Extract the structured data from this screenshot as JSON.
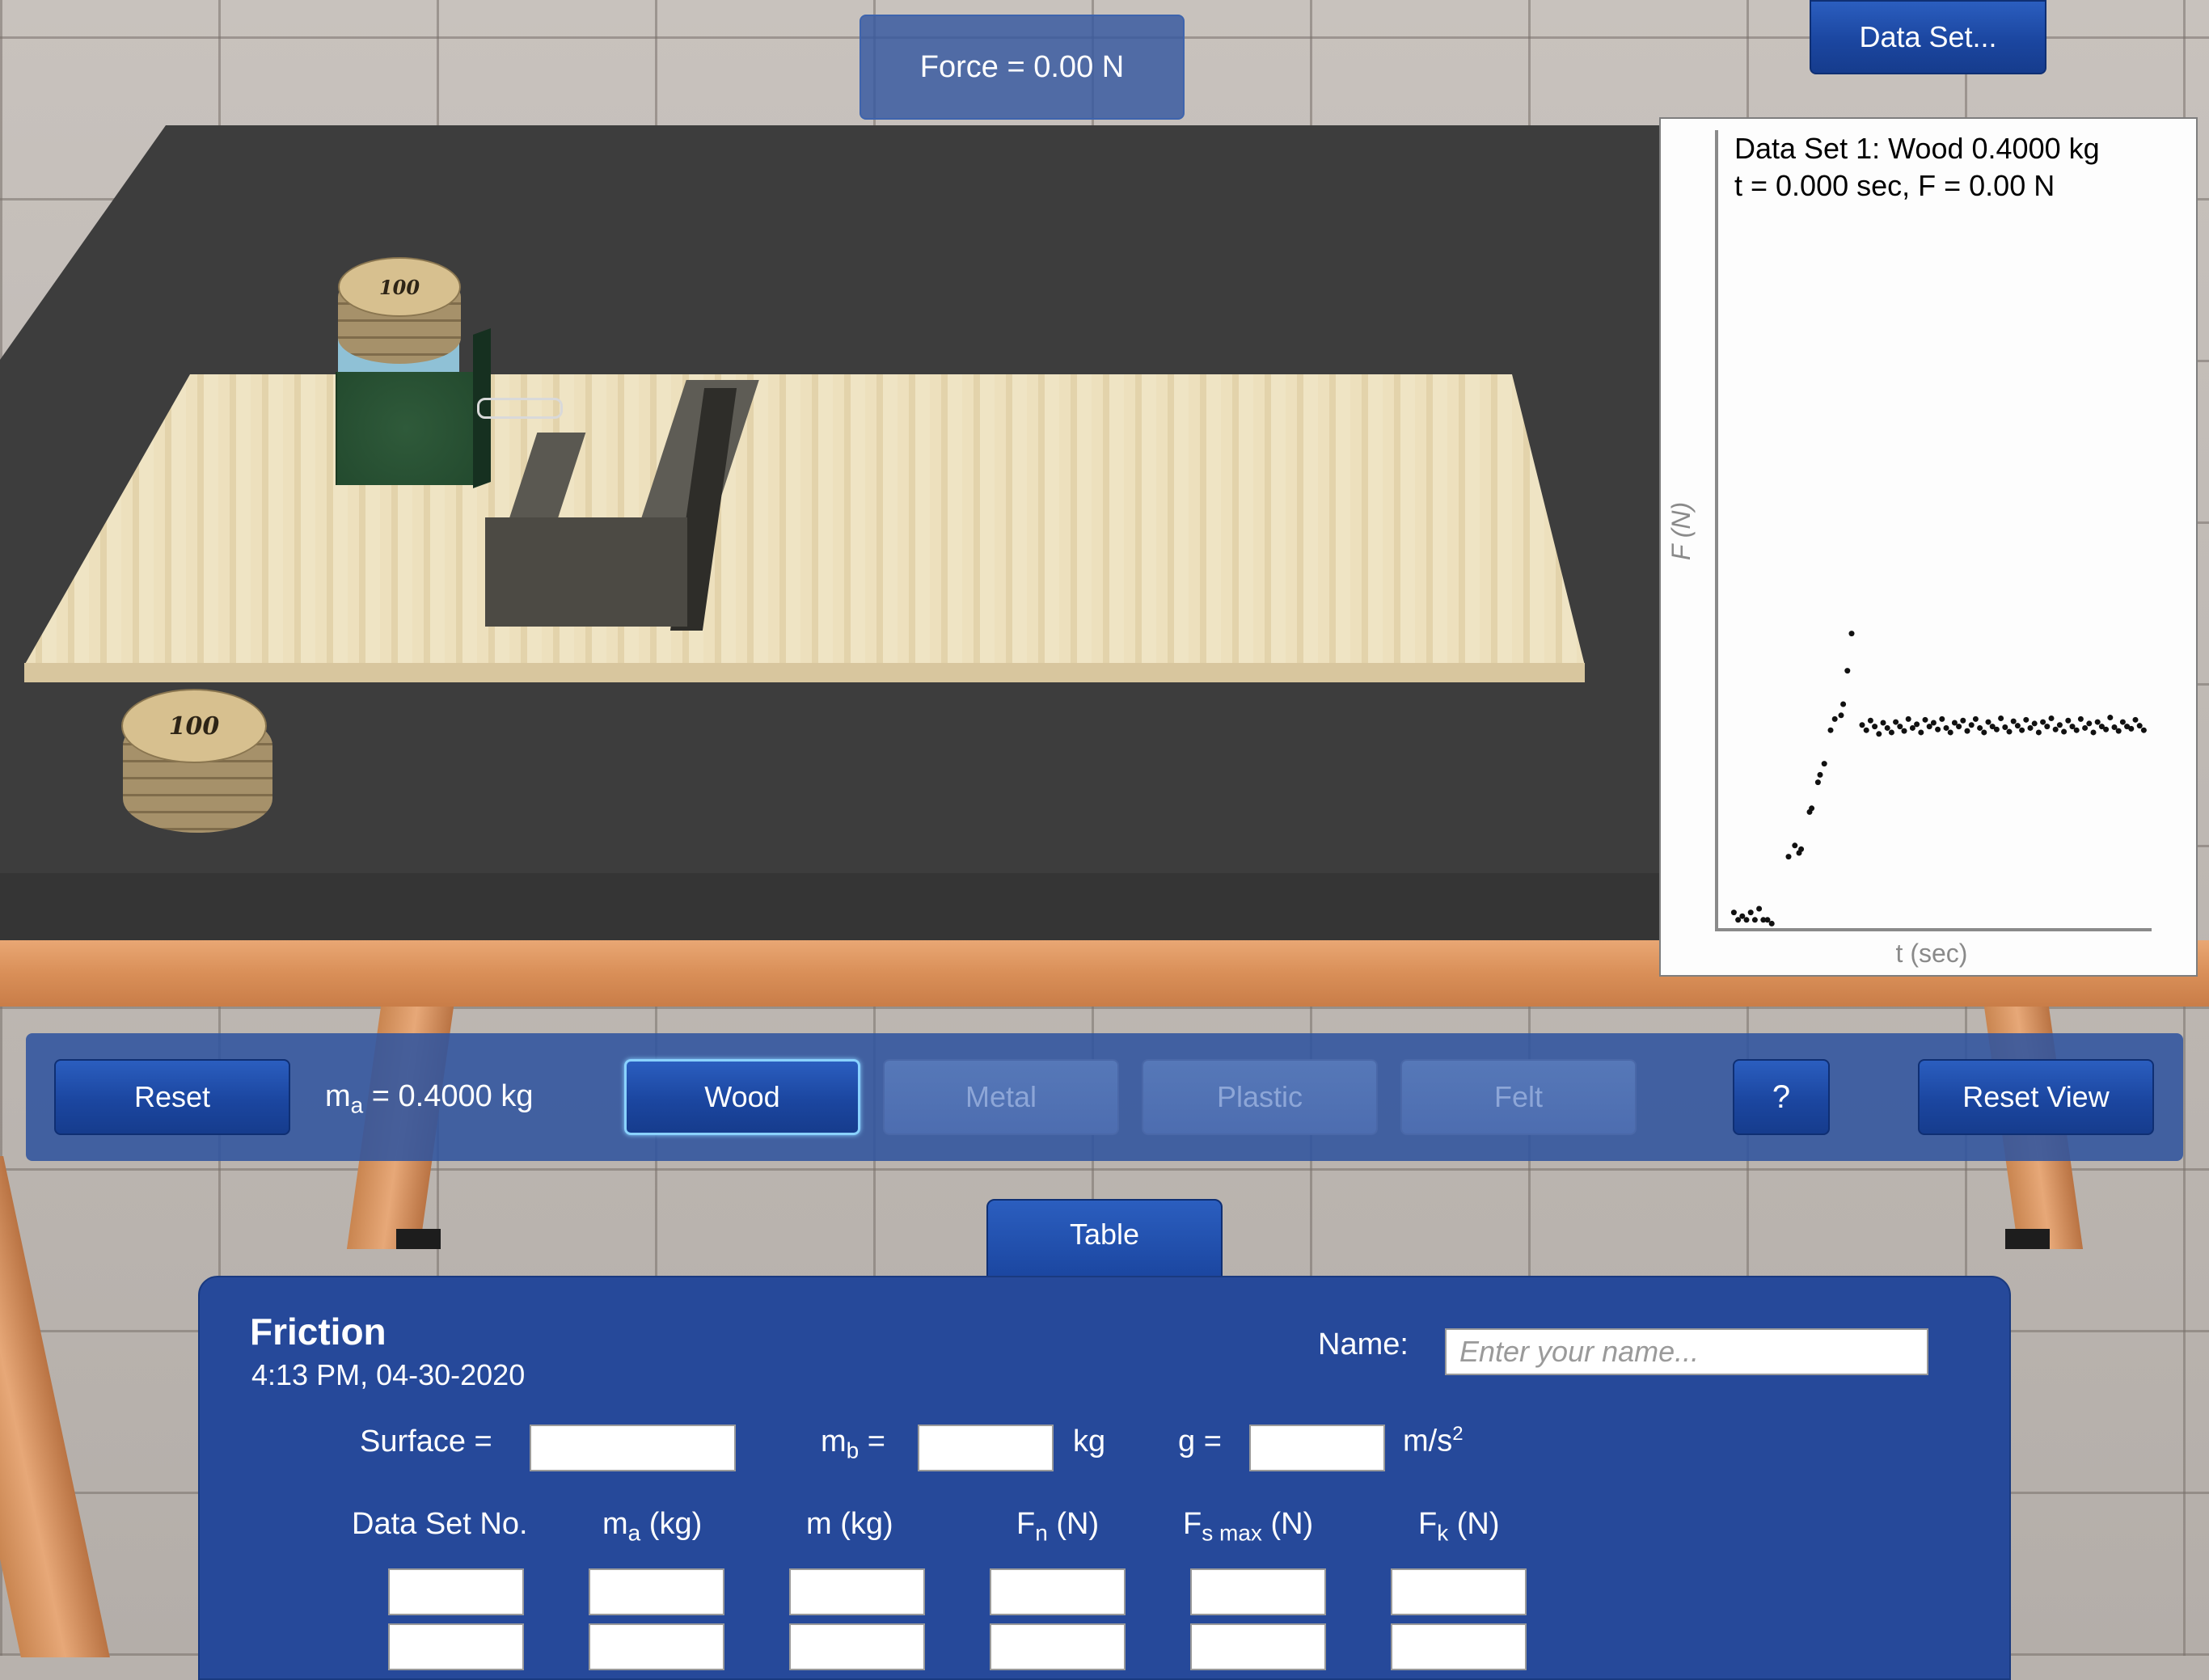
{
  "force_display": {
    "text": "Force = 0.00 N"
  },
  "header": {
    "dataset_button": "Data Set..."
  },
  "graph": {
    "title_line1": "Data Set 1: Wood 0.4000 kg",
    "title_line2": "t = 0.000 sec,  F = 0.00 N"
  },
  "weights": {
    "label": "100"
  },
  "toolbar": {
    "reset": "Reset",
    "mass_prefix": "m",
    "mass_sub": "a",
    "mass_value": " = 0.4000 kg",
    "surfaces": [
      "Wood",
      "Metal",
      "Plastic",
      "Felt"
    ],
    "selected_surface": "Wood",
    "help": "?",
    "reset_view": "Reset View"
  },
  "tab": {
    "label": "Table"
  },
  "panel": {
    "title": "Friction",
    "timestamp": "4:13 PM, 04-30-2020",
    "name_label": "Name:",
    "name_placeholder": "Enter your name...",
    "surface_label": "Surface =",
    "mb_prefix": "m",
    "mb_sub": "b",
    "mb_eq": " =",
    "mb_unit": "kg",
    "g_label": "g =",
    "g_unit": "m/s",
    "g_unit_sup": "2",
    "columns": [
      {
        "main": "Data Set No.",
        "sub": "",
        "rest": ""
      },
      {
        "main": "m",
        "sub": "a",
        "rest": " (kg)"
      },
      {
        "main": "m (kg)",
        "sub": "",
        "rest": ""
      },
      {
        "main": "F",
        "sub": "n",
        "rest": " (N)"
      },
      {
        "main": "F",
        "sub": "s max",
        "rest": " (N)"
      },
      {
        "main": "F",
        "sub": "k",
        "rest": " (N)"
      }
    ]
  },
  "chart_data": {
    "type": "scatter",
    "title": "",
    "xlabel": "t (sec)",
    "ylabel": "F (N)",
    "xlim": [
      0,
      1
    ],
    "ylim": [
      0,
      1
    ],
    "grid": false,
    "points": [
      [
        0.02,
        0.02
      ],
      [
        0.03,
        0.01
      ],
      [
        0.04,
        0.015
      ],
      [
        0.05,
        0.01
      ],
      [
        0.06,
        0.02
      ],
      [
        0.07,
        0.01
      ],
      [
        0.08,
        0.025
      ],
      [
        0.09,
        0.01
      ],
      [
        0.1,
        0.01
      ],
      [
        0.11,
        0.005
      ],
      [
        0.15,
        0.095
      ],
      [
        0.165,
        0.11
      ],
      [
        0.175,
        0.1
      ],
      [
        0.18,
        0.105
      ],
      [
        0.2,
        0.155
      ],
      [
        0.205,
        0.16
      ],
      [
        0.22,
        0.195
      ],
      [
        0.225,
        0.205
      ],
      [
        0.235,
        0.22
      ],
      [
        0.25,
        0.265
      ],
      [
        0.26,
        0.28
      ],
      [
        0.275,
        0.285
      ],
      [
        0.28,
        0.3
      ],
      [
        0.29,
        0.345
      ],
      [
        0.3,
        0.395
      ],
      [
        0.325,
        0.272
      ],
      [
        0.335,
        0.265
      ],
      [
        0.345,
        0.278
      ],
      [
        0.355,
        0.27
      ],
      [
        0.365,
        0.26
      ],
      [
        0.375,
        0.275
      ],
      [
        0.385,
        0.268
      ],
      [
        0.395,
        0.262
      ],
      [
        0.405,
        0.276
      ],
      [
        0.415,
        0.27
      ],
      [
        0.425,
        0.264
      ],
      [
        0.435,
        0.28
      ],
      [
        0.445,
        0.268
      ],
      [
        0.455,
        0.273
      ],
      [
        0.465,
        0.262
      ],
      [
        0.475,
        0.279
      ],
      [
        0.485,
        0.27
      ],
      [
        0.495,
        0.275
      ],
      [
        0.505,
        0.266
      ],
      [
        0.515,
        0.28
      ],
      [
        0.525,
        0.268
      ],
      [
        0.535,
        0.262
      ],
      [
        0.545,
        0.275
      ],
      [
        0.555,
        0.27
      ],
      [
        0.565,
        0.278
      ],
      [
        0.575,
        0.264
      ],
      [
        0.585,
        0.272
      ],
      [
        0.595,
        0.28
      ],
      [
        0.605,
        0.268
      ],
      [
        0.615,
        0.262
      ],
      [
        0.625,
        0.276
      ],
      [
        0.635,
        0.27
      ],
      [
        0.645,
        0.266
      ],
      [
        0.655,
        0.281
      ],
      [
        0.665,
        0.269
      ],
      [
        0.675,
        0.263
      ],
      [
        0.685,
        0.277
      ],
      [
        0.695,
        0.271
      ],
      [
        0.705,
        0.265
      ],
      [
        0.715,
        0.279
      ],
      [
        0.725,
        0.268
      ],
      [
        0.735,
        0.274
      ],
      [
        0.745,
        0.262
      ],
      [
        0.755,
        0.276
      ],
      [
        0.765,
        0.27
      ],
      [
        0.775,
        0.281
      ],
      [
        0.785,
        0.266
      ],
      [
        0.795,
        0.272
      ],
      [
        0.805,
        0.263
      ],
      [
        0.815,
        0.278
      ],
      [
        0.825,
        0.27
      ],
      [
        0.835,
        0.265
      ],
      [
        0.845,
        0.28
      ],
      [
        0.855,
        0.268
      ],
      [
        0.865,
        0.274
      ],
      [
        0.875,
        0.262
      ],
      [
        0.885,
        0.276
      ],
      [
        0.895,
        0.27
      ],
      [
        0.905,
        0.266
      ],
      [
        0.915,
        0.282
      ],
      [
        0.925,
        0.269
      ],
      [
        0.935,
        0.264
      ],
      [
        0.945,
        0.276
      ],
      [
        0.955,
        0.27
      ],
      [
        0.965,
        0.267
      ],
      [
        0.975,
        0.279
      ],
      [
        0.985,
        0.271
      ],
      [
        0.995,
        0.265
      ]
    ]
  },
  "colors": {
    "accent": "#1b46a0",
    "panel": "#26499a",
    "table": "#3d3d3d",
    "board": "#ede0bd"
  }
}
